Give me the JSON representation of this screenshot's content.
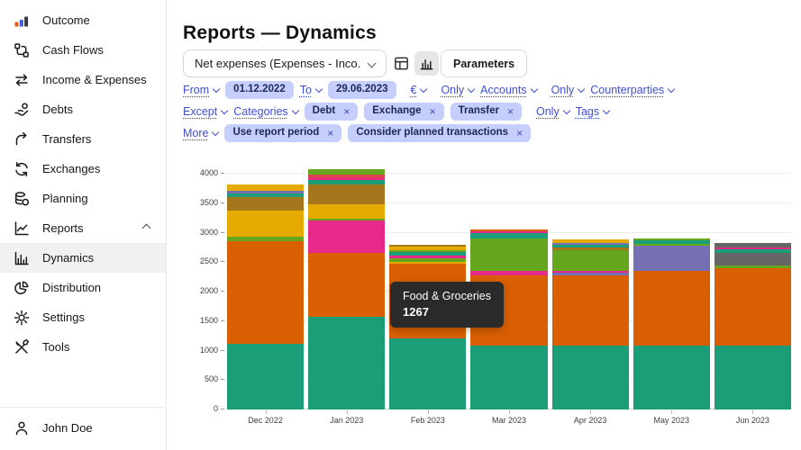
{
  "sidebar": {
    "items": [
      {
        "label": "Outcome"
      },
      {
        "label": "Cash Flows"
      },
      {
        "label": "Income & Expenses"
      },
      {
        "label": "Debts"
      },
      {
        "label": "Transfers"
      },
      {
        "label": "Exchanges"
      },
      {
        "label": "Planning"
      },
      {
        "label": "Reports"
      },
      {
        "label": "Dynamics"
      },
      {
        "label": "Distribution"
      },
      {
        "label": "Settings"
      },
      {
        "label": "Tools"
      }
    ],
    "user": {
      "name": "John Doe"
    }
  },
  "header": {
    "title": "Reports — Dynamics"
  },
  "toolbar": {
    "metric_select_value": "Net expenses (Expenses - Inco...",
    "parameters_label": "Parameters"
  },
  "filters": {
    "from_label": "From",
    "from_value": "01.12.2022",
    "to_label": "To",
    "to_value": "29.06.2023",
    "currency_label": "€",
    "accounts_mode": "Only",
    "accounts_label": "Accounts",
    "counterparties_mode": "Only",
    "counterparties_label": "Counterparties",
    "categories_mode": "Except",
    "categories_label": "Categories",
    "category_chips": [
      "Debt",
      "Exchange",
      "Transfer"
    ],
    "tags_mode": "Only",
    "tags_label": "Tags",
    "more_label": "More",
    "more_chips": [
      "Use report period",
      "Consider planned transactions"
    ]
  },
  "tooltip": {
    "title": "Food & Groceries",
    "value": "1267"
  },
  "chart_data": {
    "type": "bar",
    "stacked": true,
    "title": "",
    "xlabel": "",
    "ylabel": "",
    "ylim": [
      0,
      4000
    ],
    "yticks": [
      0,
      500,
      1000,
      1500,
      2000,
      2500,
      3000,
      3500,
      4000
    ],
    "grid": true,
    "legend": false,
    "categories": [
      "Dec 2022",
      "Jan 2023",
      "Feb 2023",
      "Mar 2023",
      "Apr 2023",
      "May 2023",
      "Jun 2023"
    ],
    "colors": {
      "teal": "#1b9e77",
      "orange": "#d95f02",
      "magenta": "#e7298a",
      "green": "#66a61e",
      "amber": "#e6ab02",
      "brown": "#a6761d",
      "purple": "#7570b3",
      "gray": "#666666",
      "red": "#d94352"
    },
    "bars": [
      {
        "month": "Dec 2022",
        "total": 3810,
        "segments": [
          [
            "teal",
            1110
          ],
          [
            "orange",
            1750
          ],
          [
            "green",
            70
          ],
          [
            "amber",
            450
          ],
          [
            "brown",
            220
          ],
          [
            "teal",
            60
          ],
          [
            "purple",
            45
          ],
          [
            "amber",
            105
          ]
        ]
      },
      {
        "month": "Jan 2023",
        "total": 4080,
        "segments": [
          [
            "teal",
            1570
          ],
          [
            "orange",
            1090
          ],
          [
            "magenta",
            540
          ],
          [
            "green",
            40
          ],
          [
            "amber",
            240
          ],
          [
            "brown",
            340
          ],
          [
            "teal",
            80
          ],
          [
            "magenta",
            30
          ],
          [
            "red",
            60
          ],
          [
            "green",
            90
          ]
        ]
      },
      {
        "month": "Feb 2023",
        "total": 2792,
        "segments": [
          [
            "teal",
            1200
          ],
          [
            "orange",
            1267
          ],
          [
            "amber",
            40
          ],
          [
            "green",
            55
          ],
          [
            "magenta",
            55
          ],
          [
            "teal",
            55
          ],
          [
            "green",
            35
          ],
          [
            "amber",
            55
          ],
          [
            "brown",
            30
          ]
        ]
      },
      {
        "month": "Mar 2023",
        "total": 3060,
        "segments": [
          [
            "teal",
            1080
          ],
          [
            "orange",
            1200
          ],
          [
            "magenta",
            70
          ],
          [
            "green",
            545
          ],
          [
            "teal",
            100
          ],
          [
            "magenta",
            35
          ],
          [
            "orange",
            20
          ],
          [
            "brown",
            10
          ]
        ]
      },
      {
        "month": "Apr 2023",
        "total": 2885,
        "segments": [
          [
            "teal",
            1080
          ],
          [
            "orange",
            1200
          ],
          [
            "purple",
            40
          ],
          [
            "magenta",
            25
          ],
          [
            "green",
            350
          ],
          [
            "brown",
            50
          ],
          [
            "teal",
            50
          ],
          [
            "purple",
            30
          ],
          [
            "amber",
            60
          ]
        ]
      },
      {
        "month": "May 2023",
        "total": 2895,
        "segments": [
          [
            "teal",
            1080
          ],
          [
            "orange",
            1265
          ],
          [
            "purple",
            440
          ],
          [
            "green",
            30
          ],
          [
            "teal",
            60
          ],
          [
            "green",
            20
          ]
        ]
      },
      {
        "month": "Jun 2023",
        "total": 2830,
        "segments": [
          [
            "teal",
            1080
          ],
          [
            "orange",
            1320
          ],
          [
            "green",
            40
          ],
          [
            "gray",
            210
          ],
          [
            "teal",
            60
          ],
          [
            "magenta",
            35
          ],
          [
            "gray",
            85
          ]
        ]
      }
    ],
    "hovered_segment": {
      "series": "Food & Groceries",
      "month": "Feb 2023",
      "value": 1267
    }
  }
}
